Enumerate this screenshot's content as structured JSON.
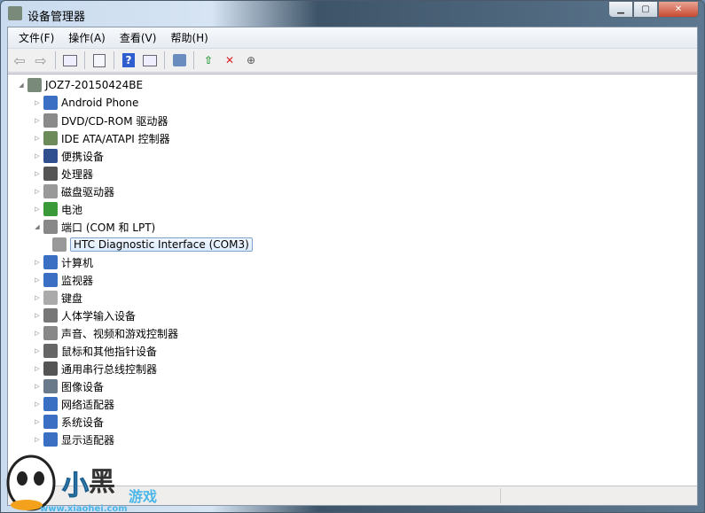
{
  "window": {
    "title": "设备管理器",
    "min": "▁",
    "max": "▢",
    "close": "✕"
  },
  "menu": [
    "文件(F)",
    "操作(A)",
    "查看(V)",
    "帮助(H)"
  ],
  "toolbar": [
    "back-icon",
    "forward-icon",
    "show-hide-tree-icon",
    "properties-icon",
    "help-icon",
    "action-pane-icon",
    "scan-hardware-icon",
    "update-driver-icon",
    "disable-device-icon",
    "uninstall-icon"
  ],
  "tree": {
    "root": "JOZ7-20150424BE",
    "items": [
      {
        "label": "Android Phone",
        "color": "#3a6fc4"
      },
      {
        "label": "DVD/CD-ROM 驱动器",
        "color": "#8a8a8a"
      },
      {
        "label": "IDE ATA/ATAPI 控制器",
        "color": "#6d8a5a"
      },
      {
        "label": "便携设备",
        "color": "#2f4f8f"
      },
      {
        "label": "处理器",
        "color": "#555"
      },
      {
        "label": "磁盘驱动器",
        "color": "#999"
      },
      {
        "label": "电池",
        "color": "#3a9a3a"
      },
      {
        "label": "端口 (COM 和 LPT)",
        "color": "#888",
        "expanded": true,
        "children": [
          "HTC Diagnostic Interface (COM3)"
        ]
      },
      {
        "label": "计算机",
        "color": "#3a6fc4"
      },
      {
        "label": "监视器",
        "color": "#3a6fc4"
      },
      {
        "label": "键盘",
        "color": "#aaa"
      },
      {
        "label": "人体学输入设备",
        "color": "#777"
      },
      {
        "label": "声音、视频和游戏控制器",
        "color": "#888"
      },
      {
        "label": "鼠标和其他指针设备",
        "color": "#666"
      },
      {
        "label": "通用串行总线控制器",
        "color": "#555"
      },
      {
        "label": "图像设备",
        "color": "#6a7a8a"
      },
      {
        "label": "网络适配器",
        "color": "#3a6fc4"
      },
      {
        "label": "系统设备",
        "color": "#3a6fc4"
      },
      {
        "label": "显示适配器",
        "color": "#3a6fc4"
      }
    ]
  },
  "watermark": {
    "text": "小黑游戏",
    "url": "www.xiaohei.com"
  }
}
